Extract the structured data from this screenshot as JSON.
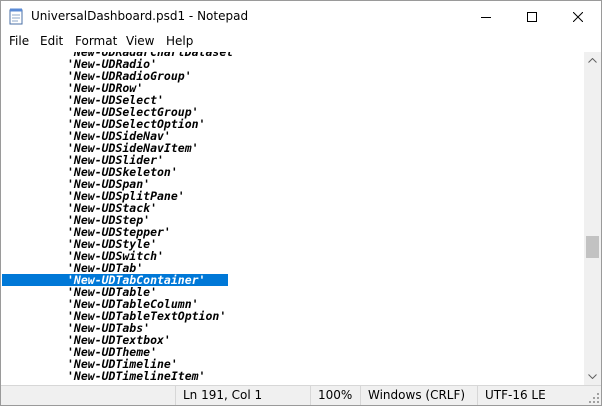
{
  "window": {
    "title": "UniversalDashboard.psd1 - Notepad",
    "icons": {
      "app": "notepad-icon",
      "minimize": "minimize-icon",
      "maximize": "maximize-icon",
      "close": "close-icon"
    }
  },
  "menu": {
    "items": [
      {
        "label": "File",
        "name": "menu-file"
      },
      {
        "label": "Edit",
        "name": "menu-edit"
      },
      {
        "label": "Format",
        "name": "menu-format"
      },
      {
        "label": "View",
        "name": "menu-view"
      },
      {
        "label": "Help",
        "name": "menu-help"
      }
    ]
  },
  "editor": {
    "selected_line_index": 19,
    "selection_color": "#0078d7",
    "lines": [
      "'New-UDRadarChartDataset'",
      "'New-UDRadio'",
      "'New-UDRadioGroup'",
      "'New-UDRow'",
      "'New-UDSelect'",
      "'New-UDSelectGroup'",
      "'New-UDSelectOption'",
      "'New-UDSideNav'",
      "'New-UDSideNavItem'",
      "'New-UDSlider'",
      "'New-UDSkeleton'",
      "'New-UDSpan'",
      "'New-UDSplitPane'",
      "'New-UDStack'",
      "'New-UDStep'",
      "'New-UDStepper'",
      "'New-UDStyle'",
      "'New-UDSwitch'",
      "'New-UDTab'",
      "'New-UDTabContainer'",
      "'New-UDTable'",
      "'New-UDTableColumn'",
      "'New-UDTableTextOption'",
      "'New-UDTabs'",
      "'New-UDTextbox'",
      "'New-UDTheme'",
      "'New-UDTimeline'",
      "'New-UDTimelineItem'"
    ]
  },
  "scrollbar": {
    "icons": {
      "up": "scroll-up-arrow-icon",
      "down": "scroll-down-arrow-icon"
    }
  },
  "status": {
    "position": "Ln 191, Col 1",
    "zoom": "100%",
    "line_ending": "Windows (CRLF)",
    "encoding": "UTF-16 LE",
    "grip_icon": "resize-grip-icon"
  }
}
